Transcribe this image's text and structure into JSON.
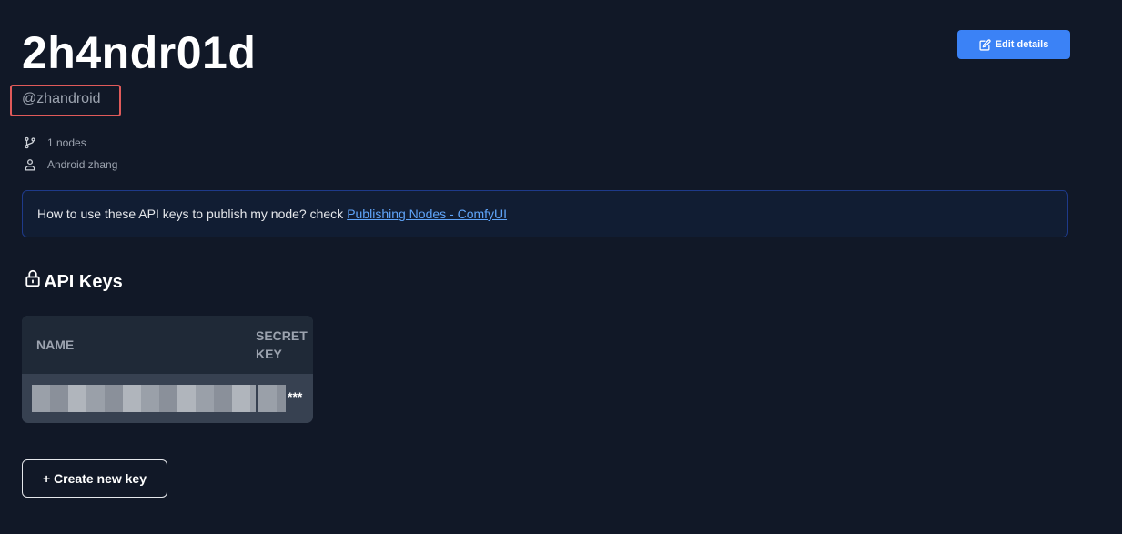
{
  "profile": {
    "display_name": "2h4ndr01d",
    "handle": "@zhandroid",
    "nodes_count": "1 nodes",
    "owner_name": "Android zhang"
  },
  "header": {
    "edit_button_label": "Edit details"
  },
  "info_banner": {
    "text": "How to use these API keys to publish my node? check",
    "link_text": "Publishing Nodes - ComfyUI"
  },
  "api_keys": {
    "section_title": "API Keys",
    "columns": [
      "NAME",
      "SECRET KEY"
    ],
    "rows": [
      {
        "name": "",
        "secret_key": "***"
      }
    ],
    "create_button_label": "+ Create new key"
  },
  "colors": {
    "background": "#111827",
    "accent": "#3b82f6",
    "link": "#60a5fa",
    "highlight_border": "#e05a5a"
  }
}
